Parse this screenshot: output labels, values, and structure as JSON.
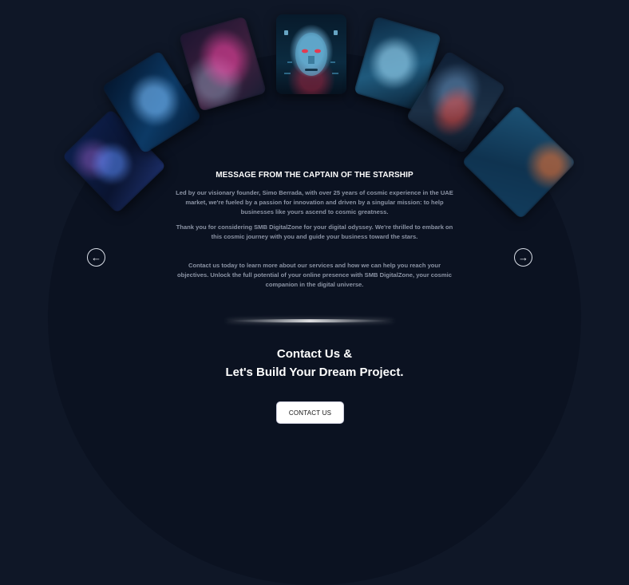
{
  "carousel": {
    "cards": [
      {
        "icon": "nebula-image"
      },
      {
        "icon": "portrait-image"
      },
      {
        "icon": "abstract-portrait-image"
      },
      {
        "icon": "cyber-face-image"
      },
      {
        "icon": "woman-portrait-image"
      },
      {
        "icon": "hand-glow-image"
      },
      {
        "icon": "spaceship-interior-image"
      }
    ],
    "prev_icon": "←",
    "next_icon": "→"
  },
  "message": {
    "title": "MESSAGE FROM THE CAPTAIN OF THE STARSHIP",
    "paragraph_1": "Led by our visionary founder, Simo Berrada, with over 25 years of cosmic experience in the UAE market, we're fueled by a passion for innovation and driven by a singular mission: to help businesses like yours ascend to cosmic greatness.",
    "paragraph_2": "Thank you for considering SMB DigitalZone for your digital odyssey. We're thrilled to embark on this cosmic journey with you and guide your business toward the stars.",
    "paragraph_3": "Contact us today to learn more about our services and how we can help you reach your objectives. Unlock the full potential of your online presence with SMB DigitalZone, your cosmic companion in the digital universe."
  },
  "cta": {
    "line_1": "Contact Us &",
    "line_2": "Let's Build Your Dream Project.",
    "button_label": "CONTACT US"
  },
  "colors": {
    "background": "#0f1727",
    "arc": "#0b1221",
    "muted_text": "#8b93a4",
    "button_bg": "#ffffff"
  }
}
